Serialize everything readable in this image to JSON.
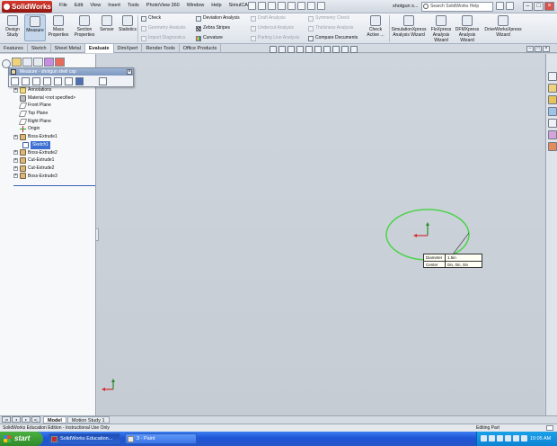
{
  "app": {
    "name": "SolidWorks",
    "menus": [
      "File",
      "Edit",
      "View",
      "Insert",
      "Tools",
      "PhotoView 360",
      "Window",
      "Help",
      "SimulCAM"
    ],
    "document_title": "shotgun s...",
    "search_placeholder": "Search SolidWorks Help"
  },
  "ribbon": {
    "big_buttons": [
      {
        "label": "Design Study",
        "name": "design-study-button"
      },
      {
        "label": "Measure",
        "name": "measure-button"
      },
      {
        "label": "Mass Properties",
        "name": "mass-properties-button"
      },
      {
        "label": "Section Properties",
        "name": "section-properties-button"
      },
      {
        "label": "Sensor",
        "name": "sensor-button"
      },
      {
        "label": "Statistics",
        "name": "statistics-button"
      }
    ],
    "col1": [
      "Check",
      "Geometry Analysis",
      "Import Diagnostics"
    ],
    "col2": [
      "Deviation Analysis",
      "Zebra Stripes",
      "Curvature"
    ],
    "col3": [
      "Draft Analysis",
      "Undercut Analysis",
      "Parting Line Analysis"
    ],
    "col4": [
      "Symmetry Check",
      "Thickness Analysis",
      "Compare Documents"
    ],
    "check_active": "Check Active ...",
    "wizards": [
      "SimulationXpress Analysis Wizard",
      "FloXpress Analysis Wizard",
      "DFMXpress Analysis Wizard",
      "DriveWorksXpress Wizard"
    ]
  },
  "tabs": [
    "Features",
    "Sketch",
    "Sheet Metal",
    "Evaluate",
    "DimXpert",
    "Render Tools",
    "Office Products"
  ],
  "active_tab": "Evaluate",
  "measure_dialog": {
    "title": "Measure - shotgun shell cap"
  },
  "feature_tree": [
    {
      "label": "Annotations",
      "icon": "annotations-icon",
      "expand": true
    },
    {
      "label": "Material <not specified>",
      "icon": "material-icon",
      "expand": false
    },
    {
      "label": "Front Plane",
      "icon": "plane-icon",
      "expand": false
    },
    {
      "label": "Top Plane",
      "icon": "plane-icon",
      "expand": false
    },
    {
      "label": "Right Plane",
      "icon": "plane-icon",
      "expand": false
    },
    {
      "label": "Origin",
      "icon": "origin-icon",
      "expand": false
    },
    {
      "label": "Boss-Extrude1",
      "icon": "extrude-icon",
      "expand": true
    },
    {
      "label": "Sketch1",
      "icon": "sketch-icon",
      "expand": false,
      "selected": true
    },
    {
      "label": "Boss-Extrude2",
      "icon": "extrude-icon",
      "expand": true
    },
    {
      "label": "Cut-Extrude1",
      "icon": "cut-extrude-icon",
      "expand": true
    },
    {
      "label": "Cut-Extrude2",
      "icon": "cut-extrude-icon",
      "expand": true
    },
    {
      "label": "Boss-Extrude3",
      "icon": "extrude-icon",
      "expand": true
    }
  ],
  "callout": {
    "diameter_label": "Diameter",
    "diameter_value": "1.5in",
    "center_label": "Center",
    "center_value": "0in, 0in, 0in"
  },
  "model_tabs": [
    "Model",
    "Motion Study 1"
  ],
  "status": {
    "left": "SolidWorks Education Edition - Instructional Use Only",
    "right": "Editing Part"
  },
  "taskbar": {
    "start": "start",
    "tasks": [
      "SolidWorks Education...",
      "3 - Paint"
    ],
    "clock": "10:05 AM"
  },
  "colors": {
    "selection_circle": "#4cd34c",
    "selected_item": "#3c6fd1",
    "taskbar": "#245edc"
  }
}
